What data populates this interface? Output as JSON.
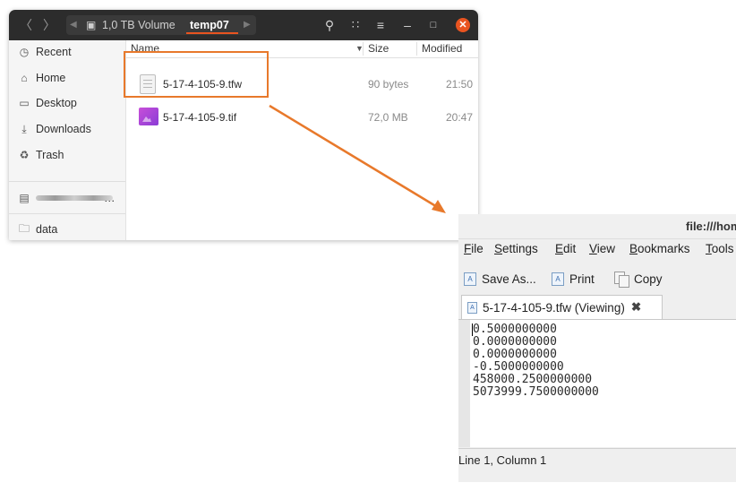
{
  "file_manager": {
    "breadcrumb": [
      {
        "label": "1,0 TB Volume",
        "icon": "drive-icon"
      },
      {
        "label": "temp07",
        "current": true
      }
    ],
    "sidebar": [
      {
        "label": "Recent",
        "icon": "clock-icon"
      },
      {
        "label": "Home",
        "icon": "home-icon"
      },
      {
        "label": "Desktop",
        "icon": "desktop-icon"
      },
      {
        "label": "Downloads",
        "icon": "download-icon"
      },
      {
        "label": "Trash",
        "icon": "trash-icon"
      },
      {
        "label": "…",
        "icon": "network-drive-icon"
      },
      {
        "label": "data",
        "icon": "folder-icon"
      }
    ],
    "columns": {
      "name": "Name",
      "size": "Size",
      "modified": "Modified"
    },
    "files": [
      {
        "name": "5-17-4-105-9.tfw",
        "size": "90 bytes",
        "modified": "21:50",
        "icon": "text-file-icon"
      },
      {
        "name": "5-17-4-105-9.tif",
        "size": "72,0 MB",
        "modified": "20:47",
        "icon": "image-file-icon"
      }
    ],
    "accent_color": "#e95420"
  },
  "editor": {
    "title": "file:///hom",
    "menu": [
      {
        "mn": "F",
        "rest": "ile"
      },
      {
        "mn": "S",
        "rest": "ettings"
      },
      {
        "mn": "E",
        "rest": "dit"
      },
      {
        "mn": "V",
        "rest": "iew"
      },
      {
        "mn": "B",
        "rest": "ookmarks"
      },
      {
        "mn": "T",
        "rest": "ools"
      }
    ],
    "toolbar": {
      "save_as": "Save As...",
      "print": "Print",
      "copy": "Copy"
    },
    "tab": {
      "label": "5-17-4-105-9.tfw (Viewing)",
      "close": "✖"
    },
    "lines": [
      "0.5000000000",
      "0.0000000000",
      "0.0000000000",
      "-0.5000000000",
      "458000.2500000000",
      "5073999.7500000000"
    ],
    "status": "Line 1, Column 1"
  },
  "annotation_color": "#e8792b"
}
